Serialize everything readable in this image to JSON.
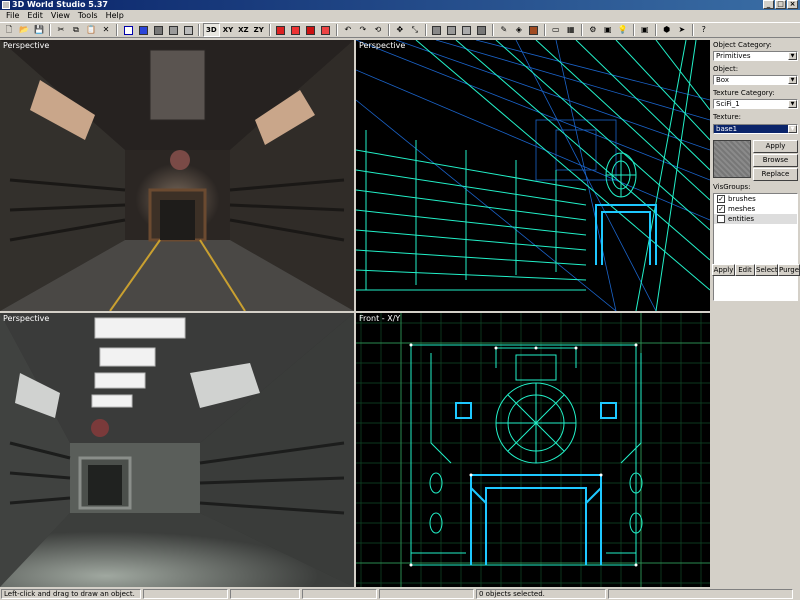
{
  "window": {
    "title": "3D World Studio 5.37"
  },
  "menu": [
    "File",
    "Edit",
    "View",
    "Tools",
    "Help"
  ],
  "toolbar": {
    "axis_3d": "3D",
    "axis_xy": "XY",
    "axis_xz": "XZ",
    "axis_zy": "ZY"
  },
  "viewports": [
    {
      "label": "Perspective"
    },
    {
      "label": "Perspective"
    },
    {
      "label": "Perspective"
    },
    {
      "label": "Front - X/Y"
    }
  ],
  "panel": {
    "object_category_label": "Object Category:",
    "object_category_value": "Primitives",
    "object_label": "Object:",
    "object_value": "Box",
    "texture_category_label": "Texture Category:",
    "texture_category_value": "SciFi_1",
    "texture_label": "Texture:",
    "texture_value": "base1",
    "apply": "Apply",
    "browse": "Browse",
    "replace": "Replace",
    "visgroups_label": "VisGroups:",
    "visgroups": [
      {
        "name": "brushes",
        "checked": true
      },
      {
        "name": "meshes",
        "checked": true
      },
      {
        "name": "entities",
        "checked": false
      }
    ],
    "vis_apply": "Apply",
    "vis_edit": "Edit",
    "vis_select": "Select",
    "vis_purge": "Purge"
  },
  "status": {
    "hint": "Left-click and drag to draw an object.",
    "selection": "0 objects selected."
  },
  "colors": {
    "wire_cyan": "#22f0c8",
    "wire_blue": "#1e90ff",
    "selection_blue": "#0a246a"
  }
}
